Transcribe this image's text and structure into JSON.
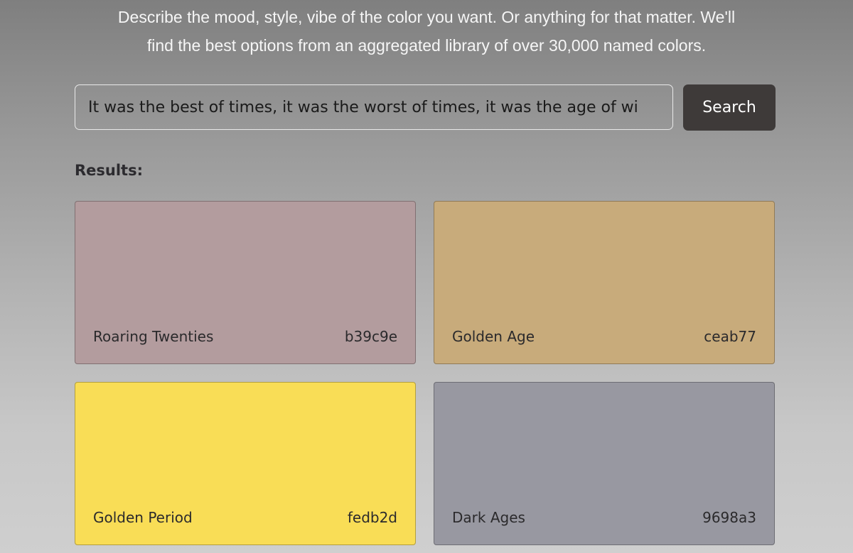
{
  "intro": {
    "line1": "Describe the mood, style, vibe of the color you want. Or anything for that matter. We'll",
    "line2": "find the best options from an aggregated library of over 30,000 named colors."
  },
  "search": {
    "value": "It was the best of times, it was the worst of times, it was the age of wi",
    "button_label": "Search"
  },
  "results": {
    "heading": "Results:",
    "items": [
      {
        "name": "Roaring Twenties",
        "hex": "b39c9e",
        "color": "#b39c9e"
      },
      {
        "name": "Golden Age",
        "hex": "ceab77",
        "color": "#c8ab7b"
      },
      {
        "name": "Golden Period",
        "hex": "fedb2d",
        "color": "#f9dd56"
      },
      {
        "name": "Dark Ages",
        "hex": "9698a3",
        "color": "#9898a1"
      }
    ]
  }
}
